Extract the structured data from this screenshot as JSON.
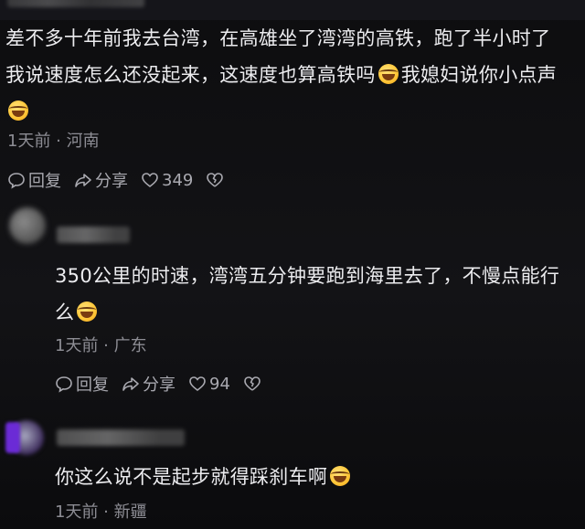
{
  "comments": [
    {
      "text": "差不多十年前我去台湾，在高雄坐了湾湾的高铁，跑了半小时了我说速度怎么还没起来，这速度也算高铁吗",
      "text_tail": "我媳妇说你小点声",
      "time": "1天前",
      "location": "河南",
      "reply_label": "回复",
      "share_label": "分享",
      "likes": "349",
      "emoji1": "laughing-tears-emoji",
      "emoji2": "grimace-emoji"
    },
    {
      "text": "350公里的时速，湾湾五分钟要跑到海里去了，不慢点能行么",
      "time": "1天前",
      "location": "广东",
      "reply_label": "回复",
      "share_label": "分享",
      "likes": "94",
      "emoji": "rolling-laughing-emoji"
    },
    {
      "text": "你这么说不是起步就得踩刹车啊",
      "time": "1天前",
      "location": "新疆",
      "emoji": "rolling-laughing-emoji"
    }
  ]
}
